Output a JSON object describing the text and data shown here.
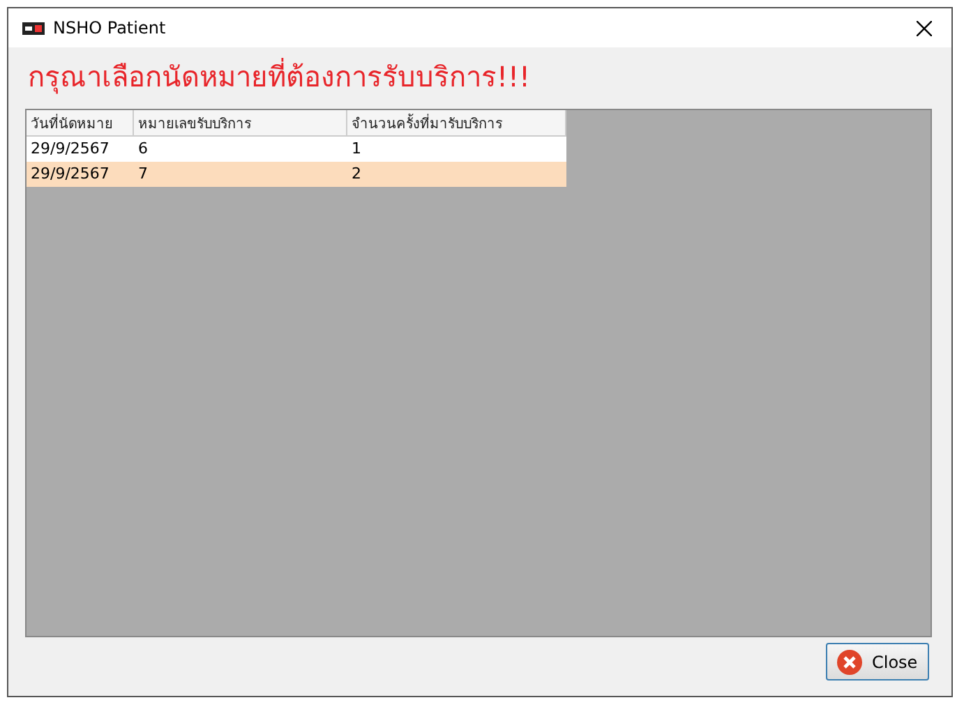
{
  "window": {
    "title": "NSHO Patient"
  },
  "heading": "กรุณาเลือกนัดหมายที่ต้องการรับบริการ!!!",
  "table": {
    "columns": [
      "วันที่นัดหมาย",
      "หมายเลขรับบริการ",
      "จำนวนครั้งที่มารับบริการ"
    ],
    "rows": [
      {
        "cells": [
          "29/9/2567",
          "6",
          "1"
        ],
        "selected": false
      },
      {
        "cells": [
          "29/9/2567",
          "7",
          "2"
        ],
        "selected": true
      }
    ]
  },
  "buttons": [
    {
      "label": "Close",
      "kind": "close"
    }
  ]
}
